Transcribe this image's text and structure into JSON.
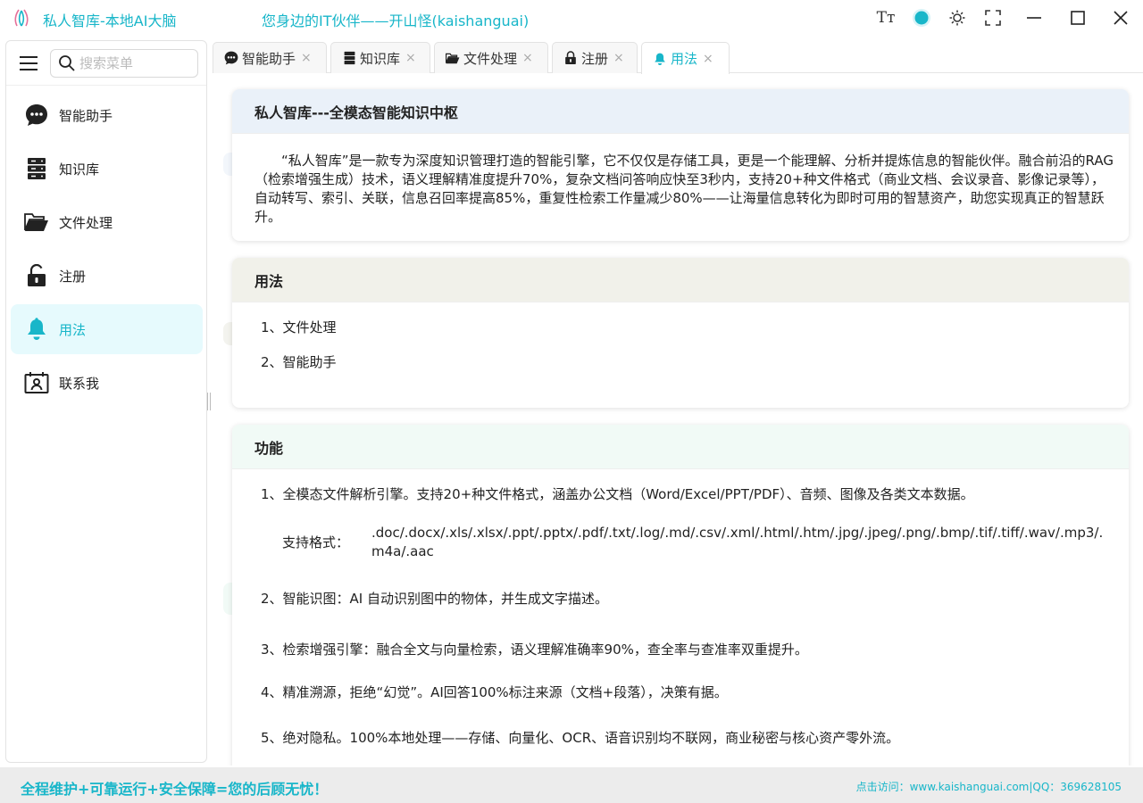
{
  "app": {
    "title": "私人智库-本地AI大脑",
    "slogan": "您身边的IT伙伴——开山怪(kaishanguai)",
    "accent": "#18b6c9"
  },
  "window_controls": {
    "font_size_icon": "Tт",
    "theme_dot_icon": "theme-color-icon",
    "brightness_icon": "sun-icon",
    "fullscreen_icon": "fullscreen-icon",
    "minimize_icon": "minimize-icon",
    "maximize_icon": "maximize-icon",
    "close_icon": "close-icon"
  },
  "sidebar": {
    "search_placeholder": "搜索菜单",
    "items": [
      {
        "label": "智能助手",
        "icon": "chat-bubble-icon",
        "active": false
      },
      {
        "label": "知识库",
        "icon": "server-icon",
        "active": false
      },
      {
        "label": "文件处理",
        "icon": "folder-open-icon",
        "active": false
      },
      {
        "label": "注册",
        "icon": "unlock-icon",
        "active": false
      },
      {
        "label": "用法",
        "icon": "bell-icon",
        "active": true
      },
      {
        "label": "联系我",
        "icon": "contact-card-icon",
        "active": false
      }
    ]
  },
  "tabs": [
    {
      "label": "智能助手",
      "icon": "chat-bubble-icon",
      "active": false
    },
    {
      "label": "知识库",
      "icon": "server-icon",
      "active": false
    },
    {
      "label": "文件处理",
      "icon": "folder-open-icon",
      "active": false
    },
    {
      "label": "注册",
      "icon": "lock-icon",
      "active": false
    },
    {
      "label": "用法",
      "icon": "bell-icon",
      "active": true
    }
  ],
  "tab_close_glyph": "×",
  "cards": {
    "intro": {
      "title": "私人智库---全模态智能知识中枢",
      "body": "“私人智库”是一款专为深度知识管理打造的智能引擎，它不仅仅是存储工具，更是一个能理解、分析并提炼信息的智能伙伴。融合前沿的RAG（检索增强生成）技术，语义理解精准度提升70%，复杂文档问答响应快至3秒内，支持20+种文件格式（商业文档、会议录音、影像记录等），自动转写、索引、关联，信息召回率提高85%，重复性检索工作量减少80%——让海量信息转化为即时可用的智慧资产，助您实现真正的智慧跃升。"
    },
    "usage": {
      "title": "用法",
      "items": [
        "1、文件处理",
        "2、智能助手"
      ]
    },
    "features": {
      "title": "功能",
      "f1": "1、全模态文件解析引擎。支持20+种文件格式，涵盖办公文档（Word/Excel/PPT/PDF）、音频、图像及各类文本数据。",
      "formats_label": "支持格式：",
      "formats_value": ".doc/.docx/.xls/.xlsx/.ppt/.pptx/.pdf/.txt/.log/.md/.csv/.xml/.html/.htm/.jpg/.jpeg/.png/.bmp/.tif/.tiff/.wav/.mp3/.m4a/.aac",
      "f2": "2、智能识图：AI 自动识别图中的物体，并生成文字描述。",
      "f3": "3、检索增强引擎：融合全文与向量检索，语义理解准确率90%，查全率与查准率双重提升。",
      "f4": "4、精准溯源，拒绝“幻觉”。AI回答100%标注来源（文档+段落），决策有据。",
      "f5": "5、绝对隐私。100%本地处理——存储、向量化、OCR、语音识别均不联网，商业秘密与核心资产零外流。"
    }
  },
  "footer": {
    "left": "全程维护+可靠运行+安全保障=您的后顾无忧！",
    "right": "点击访问：www.kaishanguai.com|QQ：369628105"
  }
}
